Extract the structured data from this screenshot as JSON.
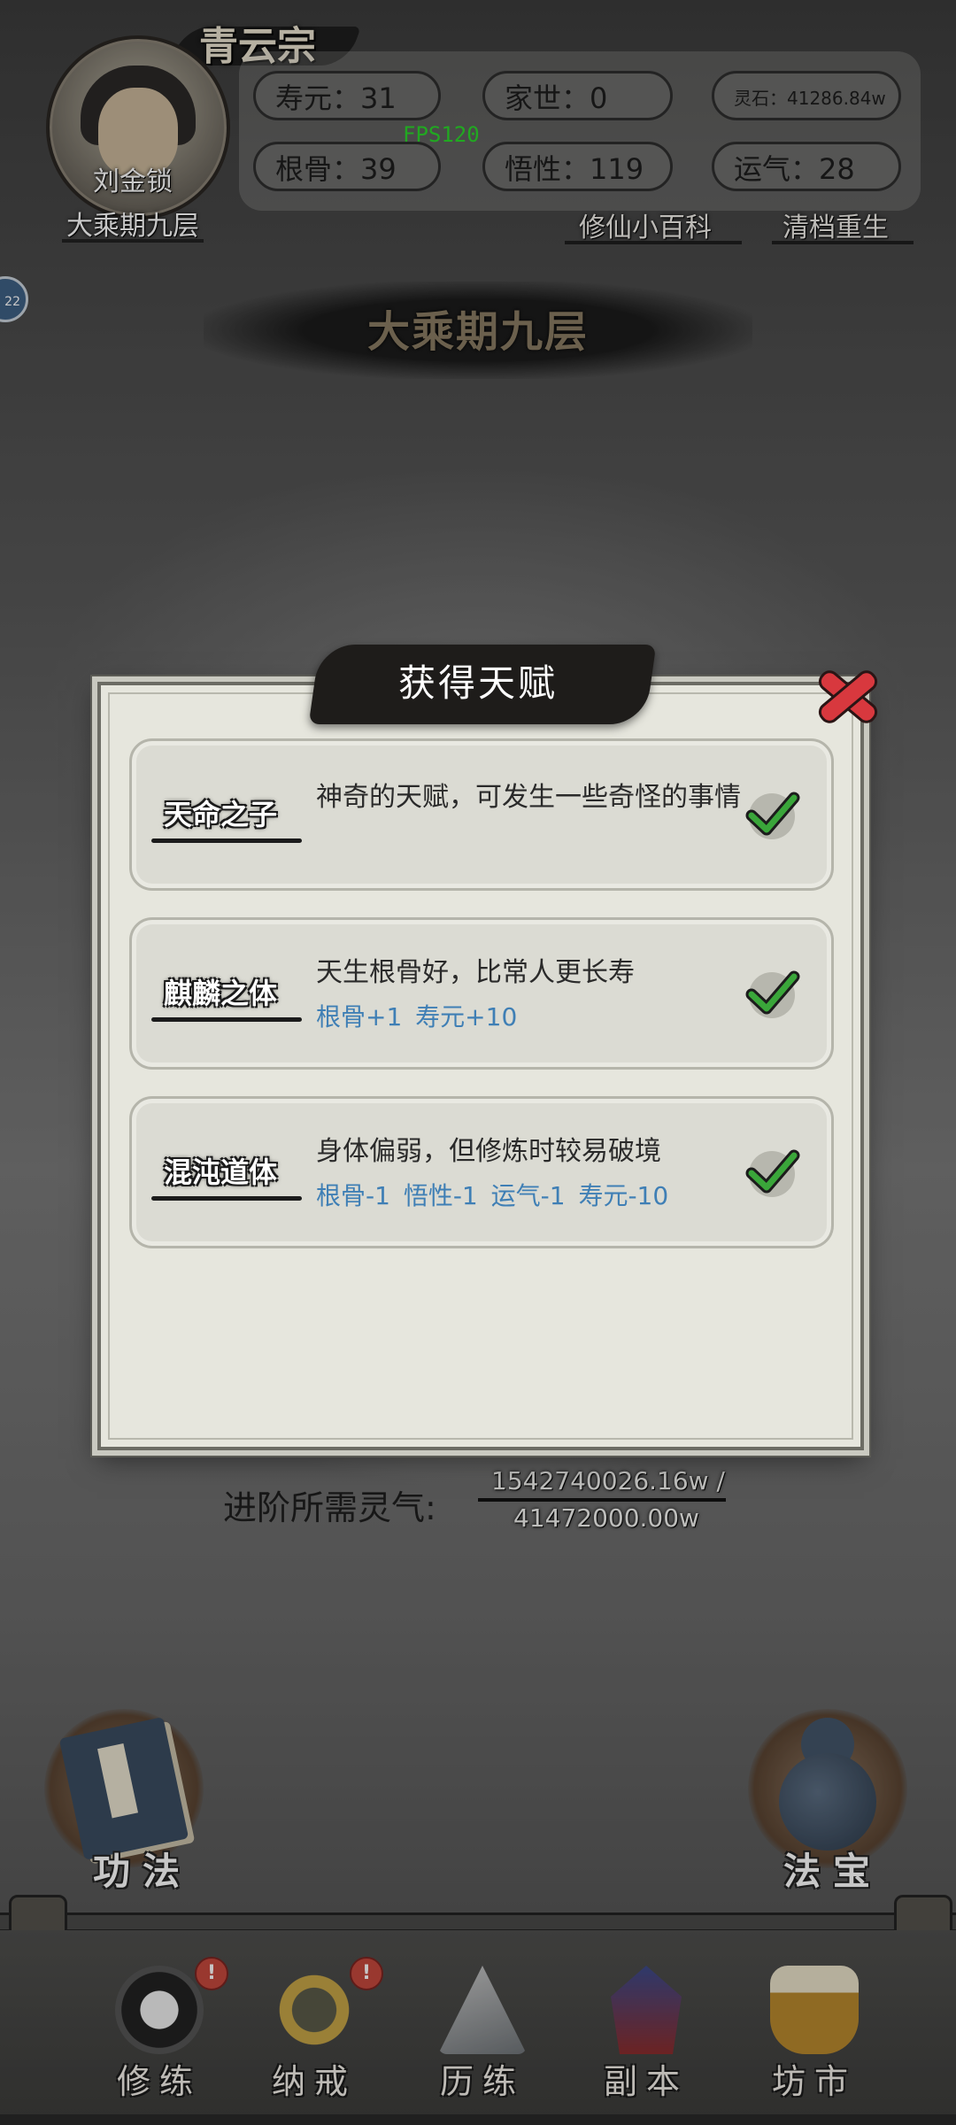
{
  "header": {
    "sect_name": "青云宗",
    "player_name": "刘金锁",
    "player_realm": "大乘期九层",
    "fps": "FPS120",
    "stats": {
      "lifespan": "寿元：31",
      "family": "家世：0",
      "spirit_stones": "灵石：41286.84w",
      "root_bone": "根骨：39",
      "comprehension": "悟性：119",
      "luck": "运气：28"
    },
    "wiki_link": "修仙小百科",
    "rebirth_link": "清档重生",
    "side_bubble": "22"
  },
  "realm_banner": "大乘期九层",
  "dialog": {
    "title": "获得天赋",
    "talents": [
      {
        "name": "天命之子",
        "desc": "神奇的天赋，可发生一些奇怪的事情",
        "effects": ""
      },
      {
        "name": "麒麟之体",
        "desc": "天生根骨好，比常人更长寿",
        "effects": "根骨+1 寿元+10"
      },
      {
        "name": "混沌道体",
        "desc": "身体偏弱，但修炼时较易破境",
        "effects": "根骨-1 悟性-1 运气-1 寿元-10"
      }
    ]
  },
  "progress": {
    "label": "进阶所需灵气:",
    "current": "1542740026.16w /",
    "required": "41472000.00w"
  },
  "shortcuts": {
    "left": "功法",
    "right": "法宝"
  },
  "bottom_nav": [
    {
      "label": "修练",
      "badge": "!"
    },
    {
      "label": "纳戒",
      "badge": "!"
    },
    {
      "label": "历练",
      "badge": ""
    },
    {
      "label": "副本",
      "badge": ""
    },
    {
      "label": "坊市",
      "badge": ""
    }
  ],
  "colors": {
    "accent_blue": "#3f7fb5",
    "close_red": "#d8383e",
    "check_green": "#3aa63a",
    "fps_green": "#2bd82b"
  }
}
